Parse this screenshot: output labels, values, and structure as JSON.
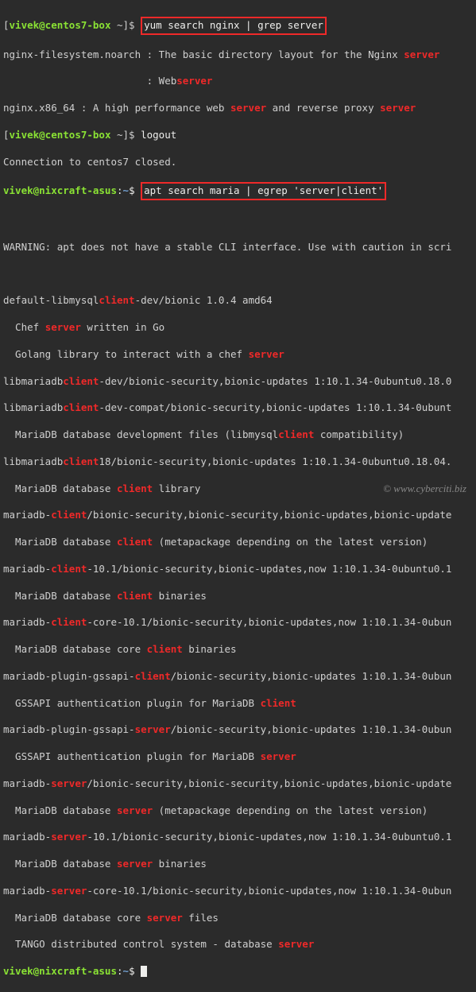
{
  "line1": {
    "user": "vivek@centos7-box",
    "path": " ~",
    "sep": "]$ ",
    "cmd": "yum search nginx | grep server"
  },
  "line2": {
    "a": "nginx-filesystem.noarch : The basic directory layout for the Nginx ",
    "hl": "server"
  },
  "line3": {
    "a": "                        : Web",
    "hl": "server"
  },
  "line4": {
    "a": "nginx.x86_64 : A high performance web ",
    "hl1": "server",
    "b": " and reverse proxy ",
    "hl2": "server"
  },
  "line5": {
    "user": "vivek@centos7-box",
    "path": " ~",
    "sep": "]$ ",
    "cmd": "logout"
  },
  "line6": {
    "t": "Connection to centos7 closed."
  },
  "line7": {
    "user": "vivek@nixcraft-asus",
    "sep": ":",
    "path": "~",
    "dollar": "$ ",
    "cmd": "apt search maria | egrep 'server|client'"
  },
  "line8": {
    "t": " "
  },
  "line9": {
    "t": "WARNING: apt does not have a stable CLI interface. Use with caution in scri"
  },
  "line10": {
    "t": " "
  },
  "line11": {
    "a": "default-libmysql",
    "hl": "client",
    "b": "-dev/bionic 1.0.4 amd64"
  },
  "line12": {
    "a": "  Chef ",
    "hl": "server",
    "b": " written in Go"
  },
  "line13": {
    "a": "  Golang library to interact with a chef ",
    "hl": "server"
  },
  "line14": {
    "a": "libmariadb",
    "hl": "client",
    "b": "-dev/bionic-security,bionic-updates 1:10.1.34-0ubuntu0.18.0"
  },
  "line15": {
    "a": "libmariadb",
    "hl": "client",
    "b": "-dev-compat/bionic-security,bionic-updates 1:10.1.34-0ubunt"
  },
  "line16": {
    "a": "  MariaDB database development files (libmysql",
    "hl": "client",
    "b": " compatibility)"
  },
  "line17": {
    "a": "libmariadb",
    "hl": "client",
    "b": "18/bionic-security,bionic-updates 1:10.1.34-0ubuntu0.18.04."
  },
  "line18": {
    "a": "  MariaDB database ",
    "hl": "client",
    "b": " library"
  },
  "line19": {
    "a": "mariadb-",
    "hl": "client",
    "b": "/bionic-security,bionic-security,bionic-updates,bionic-update"
  },
  "line20": {
    "a": "  MariaDB database ",
    "hl": "client",
    "b": " (metapackage depending on the latest version)"
  },
  "line21": {
    "a": "mariadb-",
    "hl": "client",
    "b": "-10.1/bionic-security,bionic-updates,now 1:10.1.34-0ubuntu0.1"
  },
  "line22": {
    "a": "  MariaDB database ",
    "hl": "client",
    "b": " binaries"
  },
  "line23": {
    "a": "mariadb-",
    "hl": "client",
    "b": "-core-10.1/bionic-security,bionic-updates,now 1:10.1.34-0ubun"
  },
  "line24": {
    "a": "  MariaDB database core ",
    "hl": "client",
    "b": " binaries"
  },
  "line25": {
    "a": "mariadb-plugin-gssapi-",
    "hl": "client",
    "b": "/bionic-security,bionic-updates 1:10.1.34-0ubun"
  },
  "line26": {
    "a": "  GSSAPI authentication plugin for MariaDB ",
    "hl": "client"
  },
  "line27": {
    "a": "mariadb-plugin-gssapi-",
    "hl": "server",
    "b": "/bionic-security,bionic-updates 1:10.1.34-0ubun"
  },
  "line28": {
    "a": "  GSSAPI authentication plugin for MariaDB ",
    "hl": "server"
  },
  "line29": {
    "a": "mariadb-",
    "hl": "server",
    "b": "/bionic-security,bionic-security,bionic-updates,bionic-update"
  },
  "line30": {
    "a": "  MariaDB database ",
    "hl": "server",
    "b": " (metapackage depending on the latest version)"
  },
  "line31": {
    "a": "mariadb-",
    "hl": "server",
    "b": "-10.1/bionic-security,bionic-updates,now 1:10.1.34-0ubuntu0.1"
  },
  "line32": {
    "a": "  MariaDB database ",
    "hl": "server",
    "b": " binaries"
  },
  "line33": {
    "a": "mariadb-",
    "hl": "server",
    "b": "-core-10.1/bionic-security,bionic-updates,now 1:10.1.34-0ubun"
  },
  "line34": {
    "a": "  MariaDB database core ",
    "hl": "server",
    "b": " files"
  },
  "line35": {
    "a": "  TANGO distributed control system - database ",
    "hl": "server"
  },
  "line36": {
    "user": "vivek@nixcraft-asus",
    "sep": ":",
    "path": "~",
    "dollar": "$ "
  },
  "footer": "©  www.cyberciti.biz"
}
